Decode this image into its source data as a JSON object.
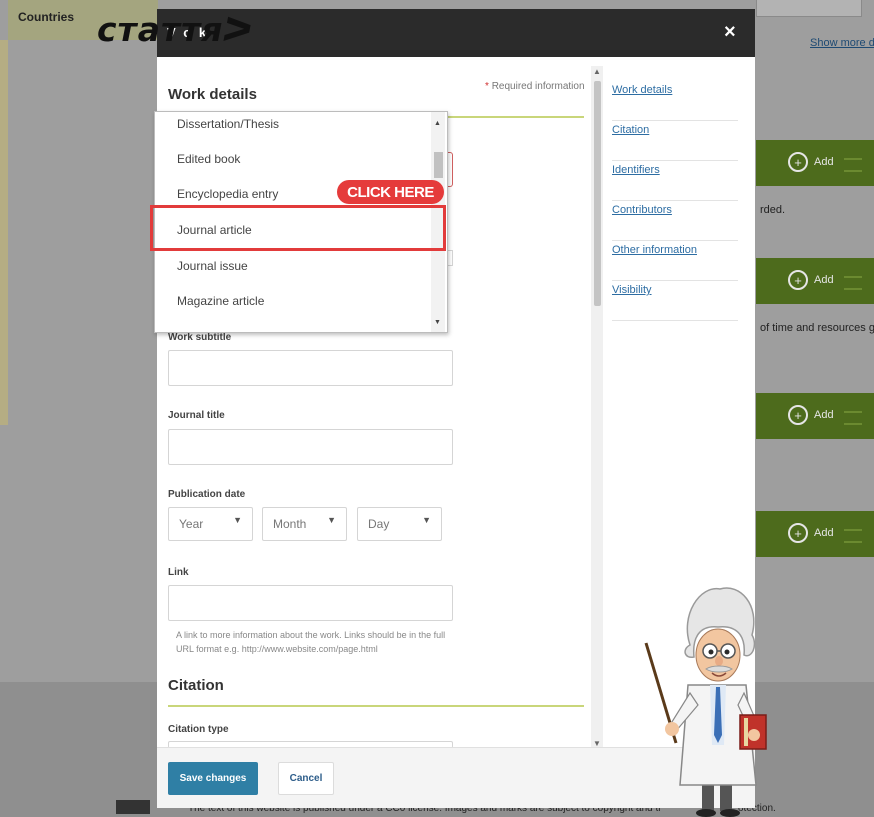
{
  "background": {
    "countries_label": "Countries",
    "show_more": "Show more d",
    "add_label": "Add",
    "text_recorded": "rded.",
    "text_time": "of time and resources g",
    "license": "The text of this website is published under a CC0 license. Images and marks are subject to copyright and tr",
    "license_end": "otection."
  },
  "overlay_title": "статтяᐳ",
  "modal": {
    "title": "V o k",
    "close": "×",
    "work_details_heading": "Work details",
    "required_info": "Required information",
    "required_star": "*",
    "work_subtitle_label": "Work subtitle",
    "journal_title_label": "Journal title",
    "publication_date_label": "Publication date",
    "year_placeholder": "Year",
    "month_placeholder": "Month",
    "day_placeholder": "Day",
    "link_label": "Link",
    "link_help": "A link to more information about the work. Links should be in the full URL format e.g. http://www.website.com/page.html",
    "citation_heading": "Citation",
    "citation_type_label": "Citation type",
    "save_button": "Save changes",
    "cancel_button": "Cancel"
  },
  "nav": {
    "items": [
      "Work details",
      "Citation",
      "Identifiers",
      "Contributors",
      "Other information",
      "Visibility"
    ]
  },
  "dropdown": {
    "items": [
      "Dissertation/Thesis",
      "Edited book",
      "Encyclopedia entry",
      "Journal article",
      "Journal issue",
      "Magazine article"
    ],
    "highlighted": "Journal article"
  },
  "callout": "CLICK HERE",
  "colors": {
    "modal_header": "#2b2b2b",
    "save_button": "#2f7fa5",
    "highlight": "#e23b3b",
    "add_panel": "#4d6b1c",
    "link": "#2d6da3"
  }
}
